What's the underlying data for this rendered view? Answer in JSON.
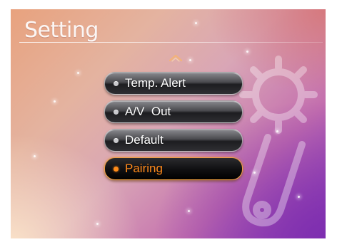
{
  "screen": {
    "title": "Setting",
    "scroll_up_icon": "chevron-up-icon",
    "background_icon": "gear-icon"
  },
  "menu": {
    "items": [
      {
        "label": "Temp. Alert",
        "selected": false
      },
      {
        "label": "A/V  Out",
        "selected": false
      },
      {
        "label": "Default",
        "selected": false
      },
      {
        "label": "Pairing",
        "selected": true
      }
    ]
  },
  "colors": {
    "selected_accent": "#ff8a1c",
    "item_text": "#ffffff"
  }
}
